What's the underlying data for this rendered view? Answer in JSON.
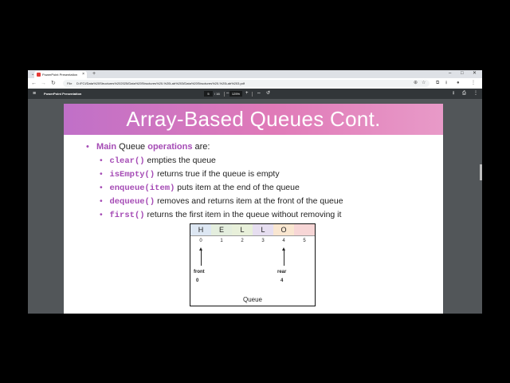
{
  "browser": {
    "tab_title": "PowerPoint Presentation",
    "new_tab": "+",
    "address_label": "File",
    "url": "D:/FCI/Data%20Structures%202025/Data%20Structures%20-%20Lab%203/Data%20Structures%20-%20Lab%203.pdf",
    "controls": {
      "minimize": "–",
      "maximize": "□",
      "close": "✕"
    }
  },
  "pdf_toolbar": {
    "title": "PowerPoint Presentation",
    "page_current": "5",
    "page_total": "/ 16",
    "zoom": "125%",
    "zoom_out": "–",
    "zoom_in": "+"
  },
  "slide": {
    "title": "Array-Based Queues Cont.",
    "intro": {
      "bullet": "•",
      "kw1": "Main",
      "t1": " Queue ",
      "kw2": "operations",
      "t2": " are:"
    },
    "ops": [
      {
        "bullet": "•",
        "code": "clear()",
        "desc": " empties the queue"
      },
      {
        "bullet": "•",
        "code": "isEmpty()",
        "desc": "  returns true if the queue is empty"
      },
      {
        "bullet": "•",
        "code": "enqueue(item)",
        "desc": "  puts item at the end of the queue"
      },
      {
        "bullet": "•",
        "code": "dequeue()",
        "desc": "  removes and returns item at the front of the queue"
      },
      {
        "bullet": "•",
        "code": "first()",
        "desc": "  returns the first item in the queue without removing it"
      }
    ],
    "diagram": {
      "cells": [
        {
          "text": "H",
          "color": "#dde7f3"
        },
        {
          "text": "E",
          "color": "#e4eede"
        },
        {
          "text": "L",
          "color": "#e8f0da"
        },
        {
          "text": "L",
          "color": "#e6def0"
        },
        {
          "text": "O",
          "color": "#f9e6d0"
        },
        {
          "text": "",
          "color": "#f7d6d6"
        }
      ],
      "indices": [
        "0",
        "1",
        "2",
        "3",
        "4",
        "5"
      ],
      "front_label": "front",
      "front_value": "0",
      "rear_label": "rear",
      "rear_value": "4",
      "caption": "Queue"
    }
  }
}
